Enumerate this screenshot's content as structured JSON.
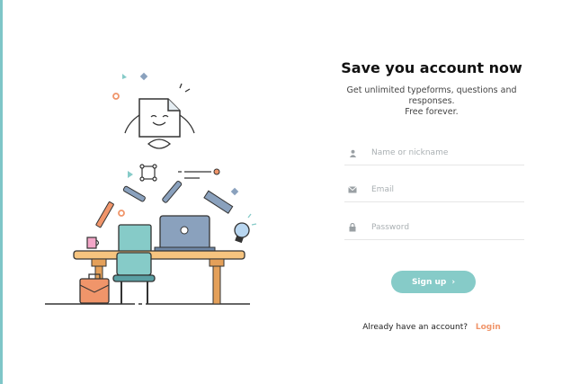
{
  "colors": {
    "accent": "#86cbc8",
    "link": "#f0956a",
    "edge": "#7fc6c8"
  },
  "form": {
    "title": "Save you account now",
    "subtitle": "Get unlimited typeforms, questions and responses.\nFree forever.",
    "fields": [
      {
        "icon": "user-icon",
        "placeholder": "Name or nickname",
        "value": ""
      },
      {
        "icon": "envelope-icon",
        "placeholder": "Email",
        "value": ""
      },
      {
        "icon": "lock-icon",
        "placeholder": "Password",
        "value": ""
      }
    ],
    "signup_label": "Sign up",
    "signup_icon": "chevron-right-icon",
    "login_prompt": "Already have an account?",
    "login_label": "Login"
  }
}
